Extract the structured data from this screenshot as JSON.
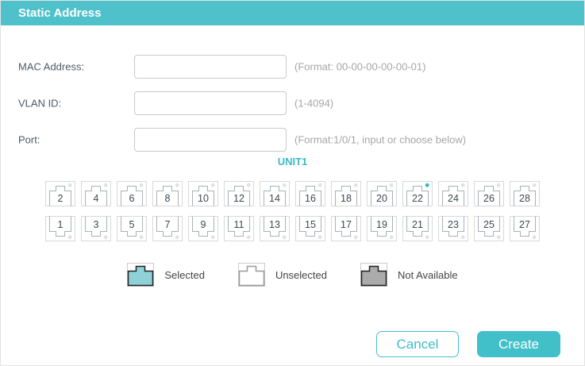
{
  "dialog": {
    "title": "Static Address"
  },
  "colors": {
    "header_teal": "#4ec1cb",
    "unit_teal": "#3bb9c4",
    "button_teal": "#42c0ca",
    "indicator_on": "#2fb9c4",
    "indicator_off": "#e2e2e2",
    "port_outer_border": "#d9d9d9",
    "port_inner_border": "#a9b1b7",
    "port_number_color": "#3c4a54",
    "selected_fill": "#8ed2d8",
    "not_available_fill": "#ababab",
    "legend_dark_border": "#222222",
    "legend_gray_border": "#9a9a9a",
    "legend_outer_border": "#cccccc"
  },
  "form": {
    "fields": [
      {
        "label": "MAC Address:",
        "value": "",
        "hint": "(Format: 00-00-00-00-00-01)"
      },
      {
        "label": "VLAN ID:",
        "value": "",
        "hint": "(1-4094)"
      },
      {
        "label": "Port:",
        "value": "",
        "hint": "(Format:1/0/1, input or choose below)"
      }
    ]
  },
  "unit": {
    "label": "UNIT1"
  },
  "port_grid": {
    "rows": [
      {
        "orientation": "top",
        "ports": [
          {
            "number": 2,
            "state": "unselected",
            "indicator": "off"
          },
          {
            "number": 4,
            "state": "unselected",
            "indicator": "off"
          },
          {
            "number": 6,
            "state": "unselected",
            "indicator": "off"
          },
          {
            "number": 8,
            "state": "unselected",
            "indicator": "off"
          },
          {
            "number": 10,
            "state": "unselected",
            "indicator": "off"
          },
          {
            "number": 12,
            "state": "unselected",
            "indicator": "off"
          },
          {
            "number": 14,
            "state": "unselected",
            "indicator": "off"
          },
          {
            "number": 16,
            "state": "unselected",
            "indicator": "off"
          },
          {
            "number": 18,
            "state": "unselected",
            "indicator": "off"
          },
          {
            "number": 20,
            "state": "unselected",
            "indicator": "off"
          },
          {
            "number": 22,
            "state": "unselected",
            "indicator": "on"
          },
          {
            "number": 24,
            "state": "unselected",
            "indicator": "off"
          },
          {
            "number": 26,
            "state": "unselected",
            "indicator": "off"
          },
          {
            "number": 28,
            "state": "unselected",
            "indicator": "off"
          }
        ]
      },
      {
        "orientation": "bottom",
        "ports": [
          {
            "number": 1,
            "state": "unselected",
            "indicator": "off"
          },
          {
            "number": 3,
            "state": "unselected",
            "indicator": "off"
          },
          {
            "number": 5,
            "state": "unselected",
            "indicator": "off"
          },
          {
            "number": 7,
            "state": "unselected",
            "indicator": "off"
          },
          {
            "number": 9,
            "state": "unselected",
            "indicator": "off"
          },
          {
            "number": 11,
            "state": "unselected",
            "indicator": "off"
          },
          {
            "number": 13,
            "state": "unselected",
            "indicator": "off"
          },
          {
            "number": 15,
            "state": "unselected",
            "indicator": "off"
          },
          {
            "number": 17,
            "state": "unselected",
            "indicator": "off"
          },
          {
            "number": 19,
            "state": "unselected",
            "indicator": "off"
          },
          {
            "number": 21,
            "state": "unselected",
            "indicator": "off"
          },
          {
            "number": 23,
            "state": "unselected",
            "indicator": "off"
          },
          {
            "number": 25,
            "state": "unselected",
            "indicator": "off"
          },
          {
            "number": 27,
            "state": "unselected",
            "indicator": "off"
          }
        ]
      }
    ]
  },
  "legend": [
    {
      "state": "selected",
      "label": "Selected"
    },
    {
      "state": "unselected",
      "label": "Unselected"
    },
    {
      "state": "not_available",
      "label": "Not Available"
    }
  ],
  "buttons": {
    "cancel": "Cancel",
    "create": "Create"
  }
}
